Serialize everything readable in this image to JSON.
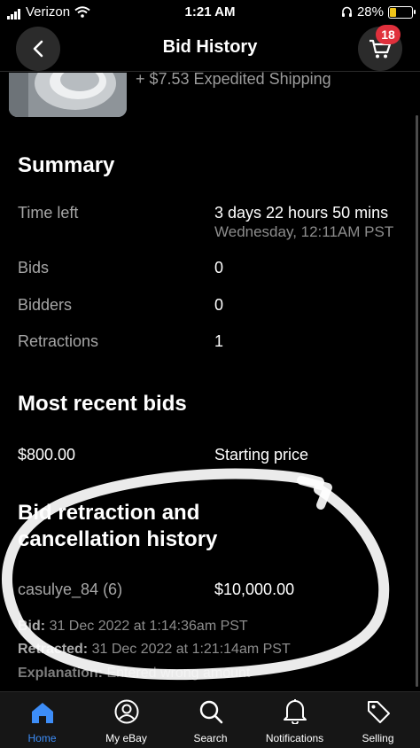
{
  "status_bar": {
    "carrier": "Verizon",
    "time": "1:21 AM",
    "battery": "28%"
  },
  "header": {
    "title": "Bid History",
    "cart_count": "18"
  },
  "item": {
    "shipping": "+ $7.53 Expedited Shipping"
  },
  "summary": {
    "title": "Summary",
    "time_left_label": "Time left",
    "time_left_value": "3 days 22 hours 50 mins",
    "end_time": "Wednesday, 12:11AM PST",
    "bids_label": "Bids",
    "bids_value": "0",
    "bidders_label": "Bidders",
    "bidders_value": "0",
    "retractions_label": "Retractions",
    "retractions_value": "1"
  },
  "recent_bids": {
    "title": "Most recent bids",
    "amount": "$800.00",
    "note": "Starting price"
  },
  "retraction_history": {
    "title_line1": "Bid retraction and",
    "title_line2": "cancellation history",
    "bidder": "casulye_84 (6)",
    "amount": "$10,000.00",
    "bid_label": "Bid:",
    "bid_value": "31 Dec 2022 at 1:14:36am PST",
    "retracted_label": "Retracted:",
    "retracted_value": "31 Dec 2022 at 1:21:14am PST",
    "explanation_label": "Explanation:",
    "explanation_value": "Entered wrong amount"
  },
  "tabs": [
    {
      "label": "Home",
      "icon": "home-icon",
      "active": true
    },
    {
      "label": "My eBay",
      "icon": "user-icon"
    },
    {
      "label": "Search",
      "icon": "search-icon"
    },
    {
      "label": "Notifications",
      "icon": "bell-icon"
    },
    {
      "label": "Selling",
      "icon": "tag-icon"
    }
  ],
  "colors": {
    "background": "#000000",
    "accent": "#3d8df7",
    "badge": "#e0303c",
    "muted_text": "#a6a6a6"
  }
}
